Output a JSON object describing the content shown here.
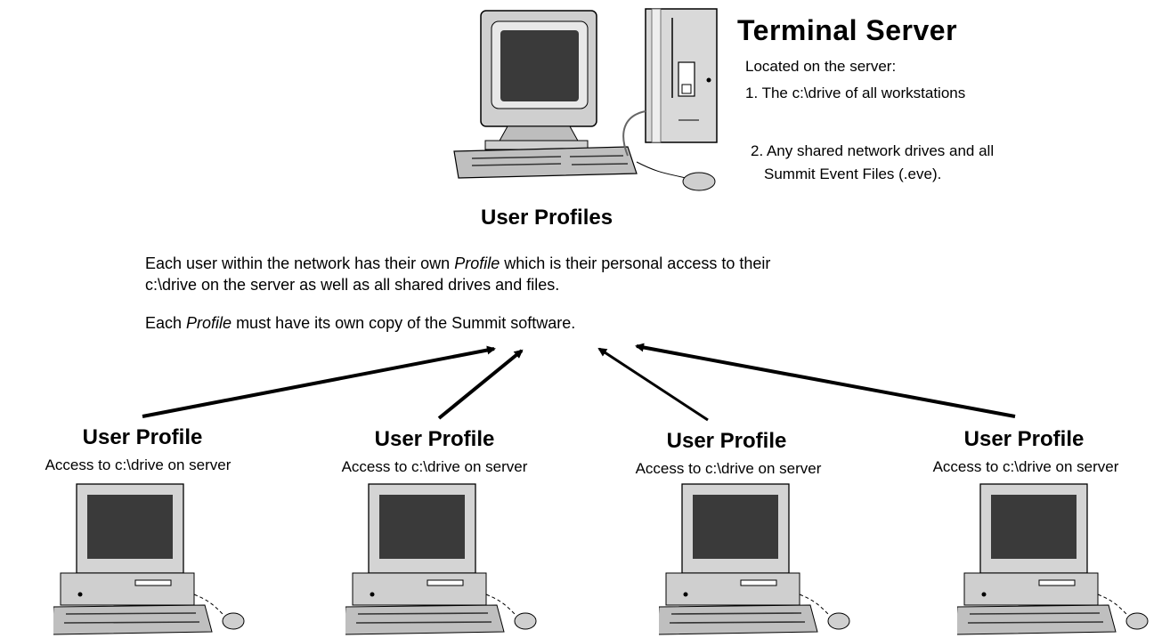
{
  "server": {
    "title": "Terminal Server",
    "intro": "Located on the server:",
    "item1": "1. The c:\\drive of all workstations",
    "item2_line1": "2. Any shared network drives and all",
    "item2_line2": "Summit Event Files (.eve)."
  },
  "profiles": {
    "title": "User Profiles",
    "para1_line1_a": "Each user within the network has their own ",
    "para1_line1_em": "Profile",
    "para1_line1_b": " which is their personal access to their",
    "para1_line2": "c:\\drive on the server as well as all shared drives and files.",
    "para2_a": "Each ",
    "para2_em": "Profile",
    "para2_b": " must have its own copy of the Summit software."
  },
  "workstations": [
    {
      "title": "User Profile",
      "subtitle": "Access to c:\\drive on server"
    },
    {
      "title": "User Profile",
      "subtitle": "Access to c:\\drive on server"
    },
    {
      "title": "User Profile",
      "subtitle": "Access to c:\\drive on server"
    },
    {
      "title": "User Profile",
      "subtitle": "Access to c:\\drive on server"
    }
  ],
  "icons": {
    "server": "terminal-server-icon",
    "workstation": "desktop-computer-icon"
  }
}
